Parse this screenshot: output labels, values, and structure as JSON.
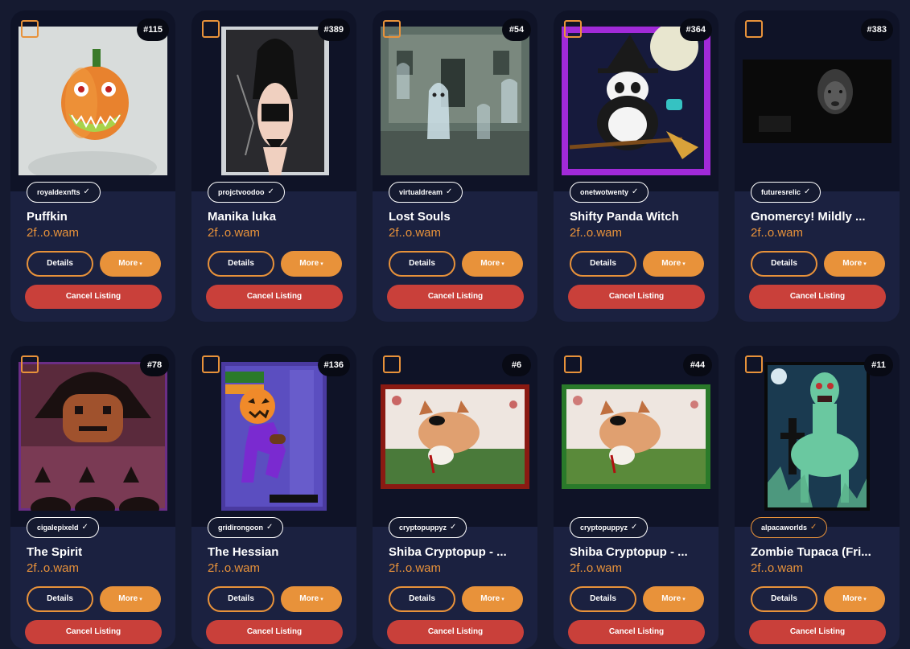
{
  "ui": {
    "details_label": "Details",
    "more_label": "More",
    "cancel_label": "Cancel Listing",
    "accent_color": "#e8923a",
    "cancel_color": "#c9403a"
  },
  "cards": [
    {
      "badge": "#115",
      "collection": "royaldexnfts",
      "title": "Puffkin",
      "owner": "2f..o.wam",
      "image": "pumpkin-monster"
    },
    {
      "badge": "#389",
      "collection": "projctvoodoo",
      "title": "Manika luka",
      "owner": "2f..o.wam",
      "image": "gothic-woman"
    },
    {
      "badge": "#54",
      "collection": "virtualdream",
      "title": "Lost Souls",
      "owner": "2f..o.wam",
      "image": "haunted-ghosts"
    },
    {
      "badge": "#364",
      "collection": "onetwotwenty",
      "title": "Shifty Panda Witch",
      "owner": "2f..o.wam",
      "image": "panda-witch"
    },
    {
      "badge": "#383",
      "collection": "futuresrelic",
      "title": "Gnomercy! Mildly ...",
      "owner": "2f..o.wam",
      "image": "dark-face"
    },
    {
      "badge": "#78",
      "collection": "cigalepixeld",
      "title": "The Spirit",
      "owner": "2f..o.wam",
      "image": "pixel-pumpkin-spirit"
    },
    {
      "badge": "#136",
      "collection": "gridirongoon",
      "title": "The Hessian",
      "owner": "2f..o.wam",
      "image": "football-pumpkin-player"
    },
    {
      "badge": "#6",
      "collection": "cryptopuppyz",
      "title": "Shiba Cryptopup - ...",
      "owner": "2f..o.wam",
      "image": "bloody-shiba-red"
    },
    {
      "badge": "#44",
      "collection": "cryptopuppyz",
      "title": "Shiba Cryptopup - ...",
      "owner": "2f..o.wam",
      "image": "bloody-shiba-green"
    },
    {
      "badge": "#11",
      "collection": "alpacaworlds",
      "title": "Zombie Tupaca (Fri...",
      "owner": "2f..o.wam",
      "image": "zombie-alpaca"
    }
  ]
}
